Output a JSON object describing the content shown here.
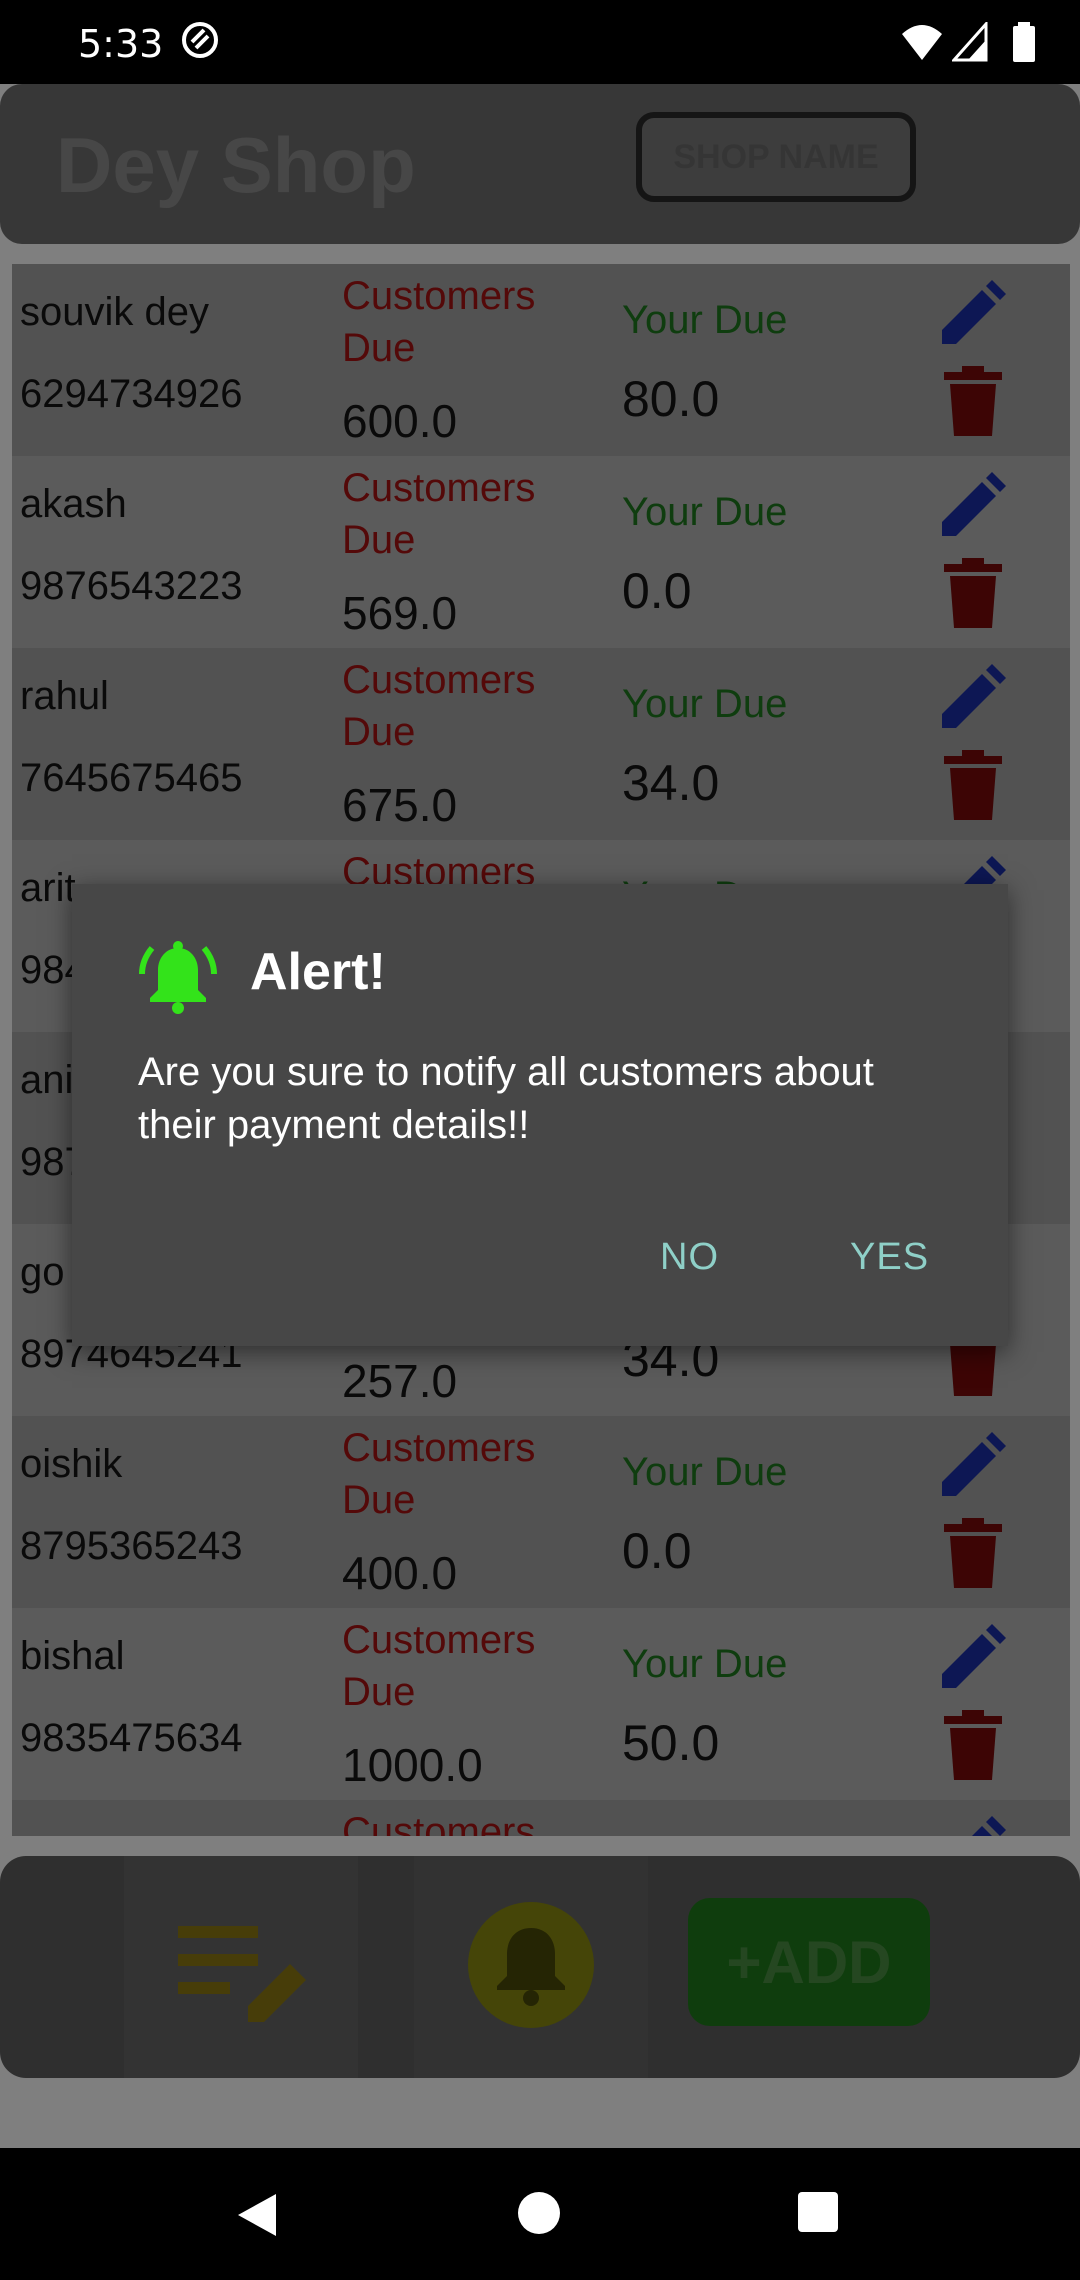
{
  "status_bar": {
    "time": "5:33"
  },
  "header": {
    "title": "Dey Shop",
    "shop_name_button": "SHOP NAME"
  },
  "customer_list": {
    "customers_due_label": "Customers Due",
    "your_due_label": "Your Due",
    "rows": [
      {
        "name": "souvik dey",
        "phone": "6294734926",
        "customers_due": "600.0",
        "your_due": "80.0"
      },
      {
        "name": "akash",
        "phone": "9876543223",
        "customers_due": "569.0",
        "your_due": "0.0"
      },
      {
        "name": "rahul",
        "phone": "7645675465",
        "customers_due": "675.0",
        "your_due": "34.0"
      },
      {
        "name": "arit",
        "phone": "984",
        "customers_due": "",
        "your_due": ""
      },
      {
        "name": "ani",
        "phone": "987",
        "customers_due": "",
        "your_due": ""
      },
      {
        "name": "go",
        "phone": "8974645241",
        "customers_due": "257.0",
        "your_due": "34.0"
      },
      {
        "name": "oishik",
        "phone": "8795365243",
        "customers_due": "400.0",
        "your_due": "0.0"
      },
      {
        "name": "bishal",
        "phone": "9835475634",
        "customers_due": "1000.0",
        "your_due": "50.0"
      },
      {
        "name": "",
        "phone": "",
        "customers_due": "",
        "your_due": ""
      }
    ]
  },
  "bottom_bar": {
    "add_button": "+ADD"
  },
  "dialog": {
    "title": "Alert!",
    "message": "Are you sure to notify all customers about their payment details!!",
    "no_button": "NO",
    "yes_button": "YES"
  },
  "colors": {
    "customers_due_text": "#a81212",
    "your_due_text": "#1f7a1f",
    "edit_icon": "#1a2fa8",
    "delete_icon": "#7a0a0a",
    "alert_icon": "#33e31a",
    "dialog_button_text": "#8fd0c8"
  },
  "icons": {
    "edit": "pencil-icon",
    "delete": "trash-icon",
    "alert": "bell-ringing-icon",
    "notify": "bell-icon",
    "list_edit": "list-edit-icon"
  }
}
